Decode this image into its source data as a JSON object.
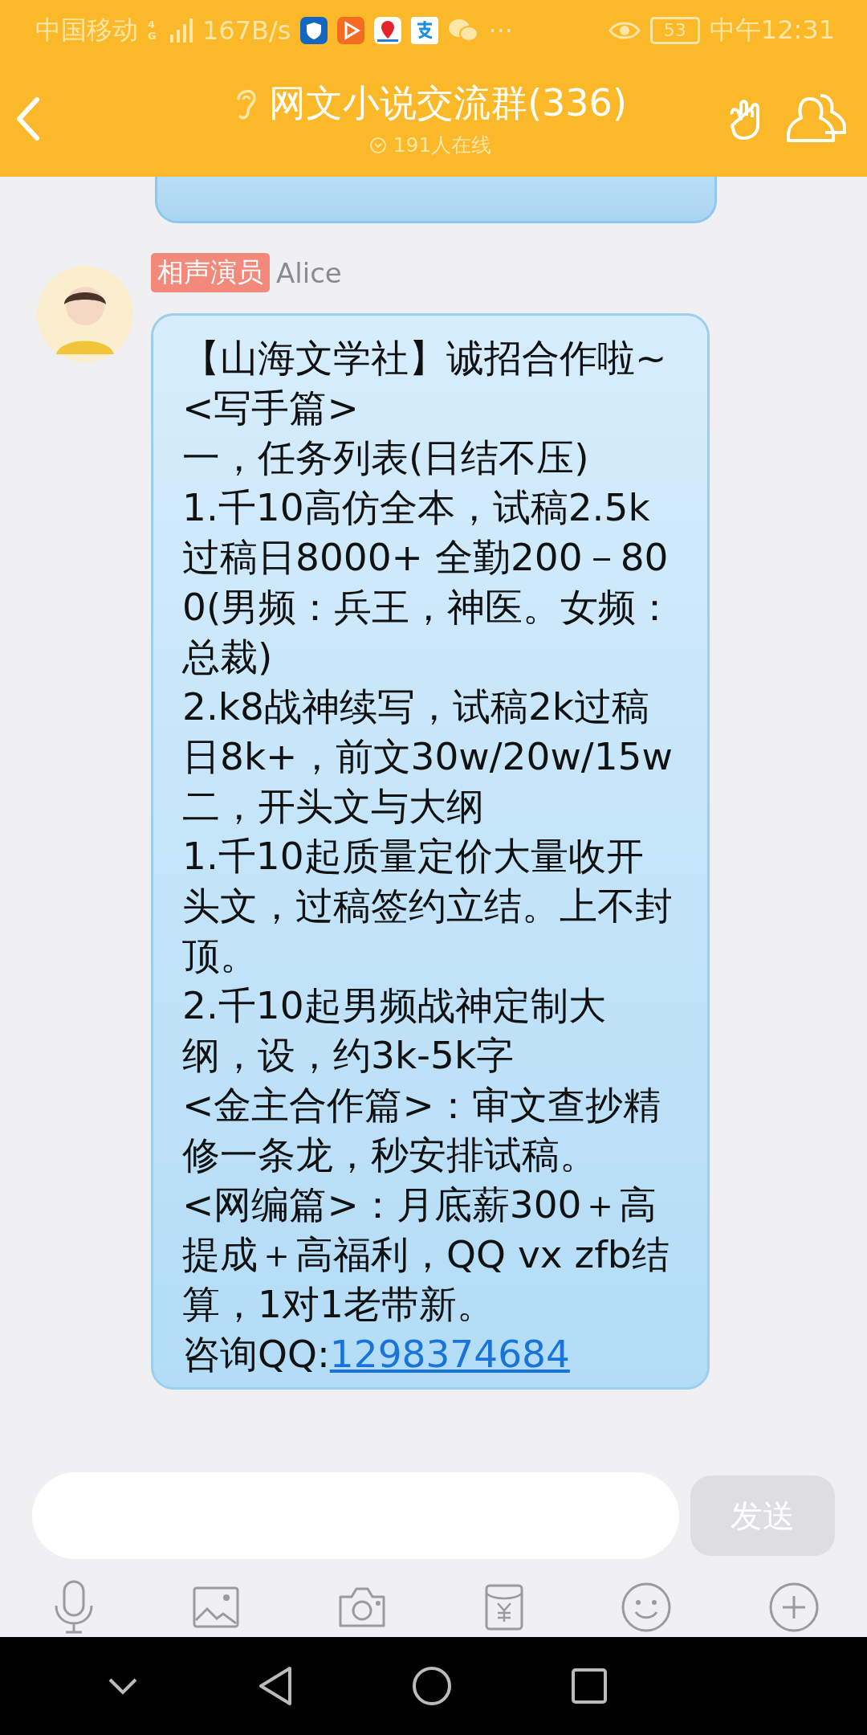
{
  "status_bar": {
    "carrier": "中国移动",
    "network": "4G",
    "speed": "167B/s",
    "more": "···",
    "battery": "53",
    "time": "中午12:31"
  },
  "header": {
    "title": "网文小说交流群(336)",
    "online": "191人在线"
  },
  "messages": [
    {
      "kind": "partial"
    },
    {
      "kind": "full",
      "tag": "相声演员",
      "sender": "Alice",
      "lines": [
        {
          "text": "【山海文学社】诚招合作啦~"
        },
        {
          "text": "<写手篇>"
        },
        {
          "text": "一，任务列表(日结不压)"
        },
        {
          "text": "1.千10高仿全本，试稿2.5k过稿日8000+ 全勤200－800(男频：兵王，神医。女频：总裁)"
        },
        {
          "text": "2.k8战神续写，试稿2k过稿日8k+，前文30w/20w/15w"
        },
        {
          "text": "二，开头文与大纲"
        },
        {
          "text": "1.千10起质量定价大量收开头文，过稿签约立结。上不封顶。"
        },
        {
          "text": "2.千10起男频战神定制大纲，设，约3k-5k字"
        },
        {
          "text": "<金主合作篇>：审文查抄精修一条龙，秒安排试稿。"
        },
        {
          "text": "<网编篇>：月底薪300＋高提成＋高福利，QQ vx zfb结算，1对1老带新。"
        },
        {
          "text": "咨询QQ:",
          "link": "1298374684"
        }
      ]
    }
  ],
  "composer": {
    "send": "发送",
    "send_disabled": true
  }
}
